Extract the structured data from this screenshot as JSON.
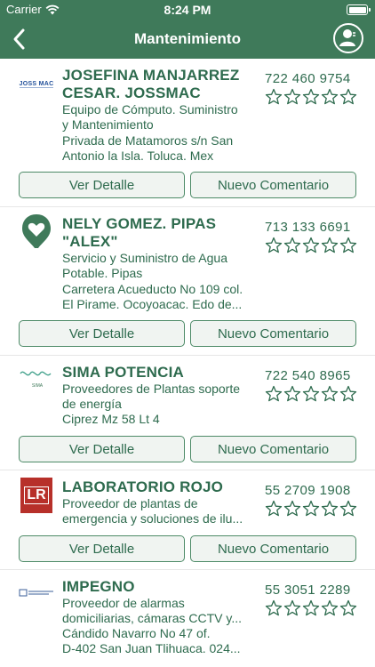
{
  "status": {
    "carrier": "Carrier",
    "time": "8:24 PM"
  },
  "nav": {
    "title": "Mantenimiento"
  },
  "icons": {
    "back": "chevron-left-icon",
    "profile": "user-circle-icon",
    "star": "star-outline-icon"
  },
  "colors": {
    "header": "#3f7a5a",
    "text": "#2e6b4e",
    "button_border": "#4d8a67",
    "button_bg": "#f0f4f1"
  },
  "buttons": {
    "detail": "Ver Detalle",
    "comment": "Nuevo Comentario"
  },
  "cards": [
    {
      "logo": "JOSS MAC",
      "name_line1": "JOSEFINA MANJARREZ",
      "name_line2": "CESAR.  JOSSMAC",
      "desc_line1": "Equipo de Cómputo.  Suministro",
      "desc_line2": "y Mantenimiento",
      "addr_line1": "Privada de Matamoros s/n San",
      "addr_line2": "Antonio la Isla. Toluca. Mex",
      "phone": "722 460 9754",
      "rating": 0
    },
    {
      "logo": "",
      "name_line1": "NELY GOMEZ. PIPAS",
      "name_line2": "\"ALEX\"",
      "desc_line1": "Servicio y Suministro de Agua",
      "desc_line2": "Potable. Pipas",
      "addr_line1": "Carretera Acueducto No 109 col.",
      "addr_line2": "El Pirame. Ocoyoacac. Edo de...",
      "phone": "713 133 6691",
      "rating": 0
    },
    {
      "logo": "SIMA",
      "name_line1": "SIMA POTENCIA",
      "desc_line1": "Proveedores de Plantas soporte",
      "desc_line2": "de energía",
      "addr_line1": "Ciprez Mz  58   Lt 4",
      "phone": "722 540 8965",
      "rating": 0
    },
    {
      "logo": "LR",
      "name_line1": "LABORATORIO ROJO",
      "desc_line1": "Proveedor de plantas de",
      "desc_line2": "emergencia y soluciones de ilu...",
      "phone": "55 2709 1908",
      "rating": 0
    },
    {
      "logo": "",
      "name_line1": "IMPEGNO",
      "desc_line1": "Proveedor de alarmas",
      "desc_line2": "domiciliarias, cámaras CCTV y...",
      "addr_line1": "Cándido Navarro No 47 of.",
      "addr_line2": "D-402 San Juan Tlihuaca. 024...",
      "phone": "55 3051 2289",
      "rating": 0
    }
  ]
}
